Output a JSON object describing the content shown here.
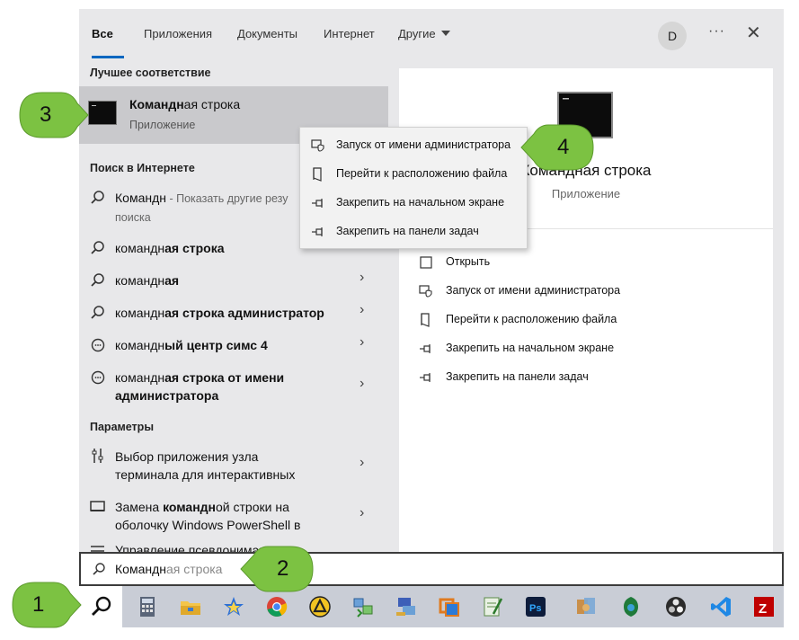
{
  "tabs": [
    {
      "label": "Все",
      "active": true
    },
    {
      "label": "Приложения"
    },
    {
      "label": "Документы"
    },
    {
      "label": "Интернет"
    },
    {
      "label": "Другие"
    }
  ],
  "avatar_letter": "D",
  "more_label": "···",
  "close_label": "✕",
  "sections": {
    "best_match": "Лучшее соответствие",
    "web_search": "Поиск в Интернете",
    "settings": "Параметры"
  },
  "best_match": {
    "title_bold": "Командн",
    "title_rest": "ая строка",
    "subtitle": "Приложение"
  },
  "web_results": [
    {
      "plain": "",
      "bold": "Командн",
      "suffix": " - Показать другие резу",
      "line2": "поиска"
    },
    {
      "plain": "командн",
      "bold": "ая строка"
    },
    {
      "plain": "командн",
      "bold": "ая"
    },
    {
      "plain": "командн",
      "bold": "ая строка администратор"
    },
    {
      "plain": "командн",
      "bold": "ый центр симс 4"
    },
    {
      "plain": "командн",
      "bold": "ая строка от имени",
      "line2": "администратора"
    }
  ],
  "settings_results": [
    {
      "line1": "Выбор приложения узла",
      "line2": "терминала для интерактивных"
    },
    {
      "line1_pre": "Замена ",
      "line1_bold": "командн",
      "line1_post": "ой строки на",
      "line2": "оболочку Windows PowerShell в"
    },
    {
      "line1": "Управление псевдонимами"
    }
  ],
  "preview": {
    "title": "Командная строка",
    "subtitle": "Приложение",
    "actions": [
      {
        "label": "Открыть",
        "icon": "open-icon"
      },
      {
        "label": "Запуск от имени администратора",
        "icon": "shield-icon"
      },
      {
        "label": "Перейти к расположению файла",
        "icon": "file-location-icon"
      },
      {
        "label": "Закрепить на начальном экране",
        "icon": "pin-icon"
      },
      {
        "label": "Закрепить на панели задач",
        "icon": "pin-icon"
      }
    ]
  },
  "context_menu": [
    {
      "label": "Запуск от имени администратора",
      "icon": "shield-icon"
    },
    {
      "label": "Перейти к расположению файла",
      "icon": "file-location-icon"
    },
    {
      "label": "Закрепить на начальном экране",
      "icon": "pin-icon"
    },
    {
      "label": "Закрепить на панели задач",
      "icon": "pin-icon"
    }
  ],
  "search_box": {
    "typed": "Командн",
    "ghost": "ая строка"
  },
  "callouts": [
    "1",
    "2",
    "3",
    "4"
  ],
  "colors": {
    "callout_green": "#7cc242",
    "accent_blue": "#0067c0"
  }
}
